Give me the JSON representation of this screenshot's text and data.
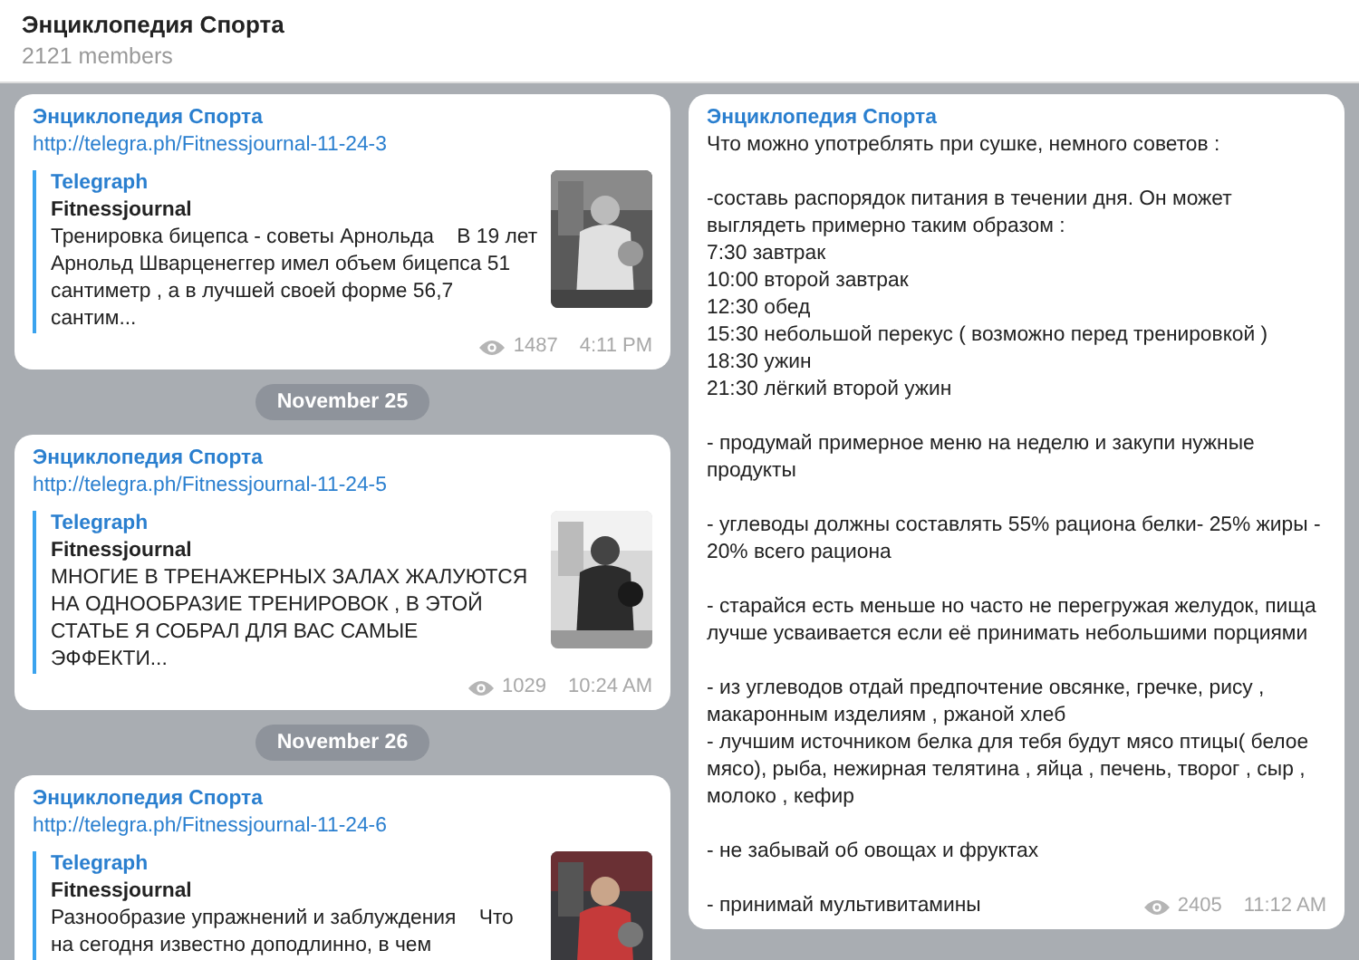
{
  "header": {
    "title": "Энциклопедия Спорта",
    "subtitle": "2121 members"
  },
  "left_feed": [
    {
      "kind": "message",
      "author": "Энциклопедия Спорта",
      "link": "http://telegra.ph/Fitnessjournal-11-24-3",
      "preview": {
        "site": "Telegraph",
        "title": "Fitnessjournal",
        "text": "Тренировка бицепса - советы Арнольда    В 19 лет Арнольд Шварценеггер имел объем бицепса 51 сантиметр , а в лучшей своей форме 56,7 сантим..."
      },
      "views": "1487",
      "time": "4:11 PM"
    },
    {
      "kind": "date",
      "label": "November 25"
    },
    {
      "kind": "message",
      "author": "Энциклопедия Спорта",
      "link": "http://telegra.ph/Fitnessjournal-11-24-5",
      "preview": {
        "site": "Telegraph",
        "title": "Fitnessjournal",
        "text": "МНОГИЕ В ТРЕНАЖЕРНЫХ ЗАЛАХ ЖАЛУЮТСЯ НА ОДНООБРАЗИЕ ТРЕНИРОВОК , В ЭТОЙ СТАТЬЕ Я СОБРАЛ ДЛЯ ВАС САМЫЕ ЭФФЕКТИ..."
      },
      "views": "1029",
      "time": "10:24 AM"
    },
    {
      "kind": "date",
      "label": "November 26"
    },
    {
      "kind": "message",
      "author": "Энциклопедия Спорта",
      "link": "http://telegra.ph/Fitnessjournal-11-24-6",
      "preview": {
        "site": "Telegraph",
        "title": "Fitnessjournal",
        "text": "Разнообразие упражнений и заблуждения    Что на сегодня известно доподлинно, в чем"
      }
    }
  ],
  "right_message": {
    "author": "Энциклопедия Спорта",
    "paragraphs": [
      "Что можно употреблять при сушке, немного советов :",
      "-составь распорядок питания в течении дня. Он может выглядеть примерно таким образом :\n7:30 завтрак\n10:00 второй завтрак\n12:30 обед\n15:30 небольшой перекус ( возможно перед тренировкой )\n18:30 ужин\n21:30 лёгкий второй ужин",
      "- продумай примерное меню на неделю и закупи нужные продукты",
      "- углеводы должны составлять 55% рациона белки- 25% жиры - 20% всего рациона",
      "- старайся есть меньше но часто не перегружая желудок, пища лучше усваивается если её принимать небольшими порциями",
      "- из углеводов отдай предпочтение овсянке, гречке, рису , макаронным изделиям , ржаной хлеб\n- лучшим источником белка для тебя будут мясо птицы( белое мясо), рыба, нежирная телятина , яйца , печень, творог , сыр , молоко , кефир",
      "- не забывай об овощах и фруктах",
      "- принимай мультивитамины"
    ],
    "views": "2405",
    "time": "11:12 AM"
  }
}
